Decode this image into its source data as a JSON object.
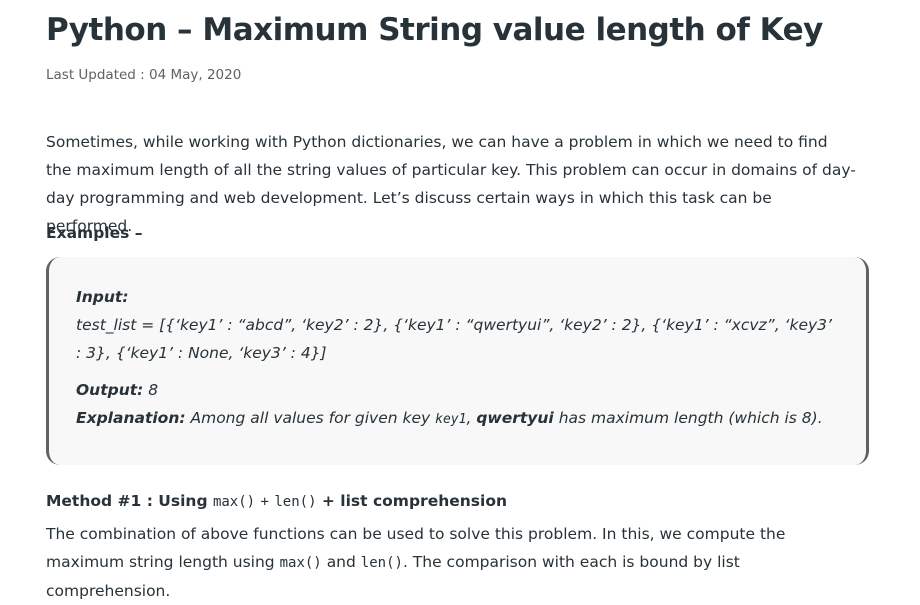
{
  "article": {
    "title": "Python – Maximum String value length of Key",
    "last_updated": "Last Updated : 04 May, 2020",
    "intro": "Sometimes, while working with Python dictionaries, we can have a problem in which we need to find the maximum length of all the string values of particular key. This problem can occur in domains of day-day programming and web development. Let’s discuss certain ways in which this task can be performed."
  },
  "examples": {
    "heading": "Examples –",
    "input_label": "Input:",
    "input_value": "test_list = [{‘key1’ : “abcd”, ‘key2’ : 2}, {‘key1’ : “qwertyui”, ‘key2’ : 2}, {‘key1’ : “xcvz”, ‘key3’ : 3}, {‘key1’ : None, ‘key3’ : 4}]",
    "output_label": "Output:",
    "output_value": "8",
    "explanation_label": "Explanation:",
    "explanation_pre": "Among all values for given key",
    "explanation_key": "key1",
    "explanation_sep": ",",
    "explanation_bold": "qwertyui",
    "explanation_post": "has maximum length (which is 8)."
  },
  "method1": {
    "heading_prefix": "Method #1 : Using",
    "heading_max": "max()",
    "heading_plus1": "+",
    "heading_len": "len()",
    "heading_suffix": "+ list comprehension",
    "body_pre": "The combination of above functions can be used to solve this problem. In this, we compute the maximum string length using",
    "body_max": "max()",
    "body_and": "and",
    "body_len": "len()",
    "body_post": ". The comparison with each is bound by list comprehension."
  },
  "colors": {
    "text": "#273239",
    "muted": "#616161",
    "box_background": "#f8f8f8",
    "box_border": "#5f6368"
  }
}
